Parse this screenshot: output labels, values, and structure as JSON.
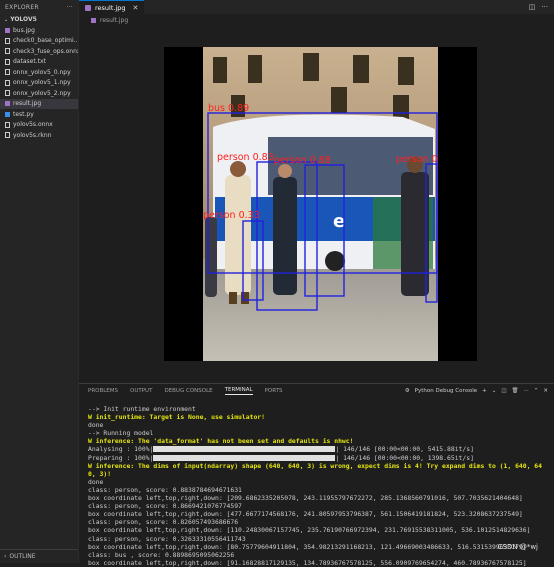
{
  "sidebar": {
    "header": "EXPLORER",
    "folder": "YOLOV5",
    "files": [
      {
        "name": "bus.jpg",
        "icon": "image-file-icon",
        "color": "#a074c4",
        "selected": false
      },
      {
        "name": "check0_base_optimi...",
        "icon": "file-icon",
        "color": "#cccccc",
        "selected": false
      },
      {
        "name": "check3_fuse_ops.onnx",
        "icon": "file-icon",
        "color": "#cccccc",
        "selected": false
      },
      {
        "name": "dataset.txt",
        "icon": "text-file-icon",
        "color": "#cccccc",
        "selected": false
      },
      {
        "name": "onnx_yolov5_0.npy",
        "icon": "file-icon",
        "color": "#cccccc",
        "selected": false
      },
      {
        "name": "onnx_yolov5_1.npy",
        "icon": "file-icon",
        "color": "#cccccc",
        "selected": false
      },
      {
        "name": "onnx_yolov5_2.npy",
        "icon": "file-icon",
        "color": "#cccccc",
        "selected": false
      },
      {
        "name": "result.jpg",
        "icon": "image-file-icon",
        "color": "#a074c4",
        "selected": true
      },
      {
        "name": "test.py",
        "icon": "python-file-icon",
        "color": "#3b8eea",
        "selected": false
      },
      {
        "name": "yolov5s.onnx",
        "icon": "file-icon",
        "color": "#cccccc",
        "selected": false
      },
      {
        "name": "yolov5s.rknn",
        "icon": "file-icon",
        "color": "#cccccc",
        "selected": false
      }
    ],
    "outline": "OUTLINE"
  },
  "editor": {
    "tab_label": "result.jpg",
    "breadcrumb": "result.jpg"
  },
  "image": {
    "detections": [
      {
        "label": "bus  0.89"
      },
      {
        "label": "person  0.88"
      },
      {
        "label": "person  0.87"
      },
      {
        "label": "person  0.83"
      },
      {
        "label": "person  0.33"
      }
    ],
    "box_color": "#2222dd",
    "label_color": "#ff2020"
  },
  "panel": {
    "tabs": [
      "PROBLEMS",
      "OUTPUT",
      "DEBUG CONSOLE",
      "TERMINAL",
      "PORTS"
    ],
    "active_tab": "TERMINAL",
    "console_select": "Python Debug Console",
    "lines": [
      "--> Init runtime environment",
      "W init_runtime: Target is None, use simulator!",
      "done",
      "--> Running model",
      "W inference: The 'data_format' has not been set and defaults is nhwc!",
      "Analysing : 100%|",
      "| 146/146 [00:00<00:00, 5415.88it/s]",
      "Preparing : 100%|",
      "| 146/146 [00:00<00:00, 1398.65it/s]",
      "W inference: The dims of input(ndarray) shape (640, 640, 3) is wrong, expect dims is 4! Try expand dims to (1, 640, 64",
      "0, 3)!",
      "done",
      "class: person, score: 0.8838784694671631",
      "box coordinate left,top,right,down: [209.6862335205078, 243.11955797672272, 285.1368560791016, 507.7035621404648]",
      "class: person, score: 0.8669421076774597",
      "box coordinate left,top,right,down: [477.6677174568176, 241.80597953796387, 561.1506419181824, 523.3208637237549]",
      "class: person, score: 0.826057493686676",
      "box coordinate left,top,right,down: [110.24830067157745, 235.76190766972394, 231.76915538311005, 536.1012514829636]",
      "class: person, score: 0.32633310556411743",
      "box coordinate left,top,right,down: [80.75779604911804, 354.98213291168213, 121.49669003486633, 516.5315399633179]",
      "class: bus , score: 0.8898695095062256",
      "box coordinate left,top,right,down: [91.16828817129135, 134.78936767578125, 556.0909769654274, 460.78936767578125]"
    ],
    "watermark": "CSDN @*wj"
  }
}
